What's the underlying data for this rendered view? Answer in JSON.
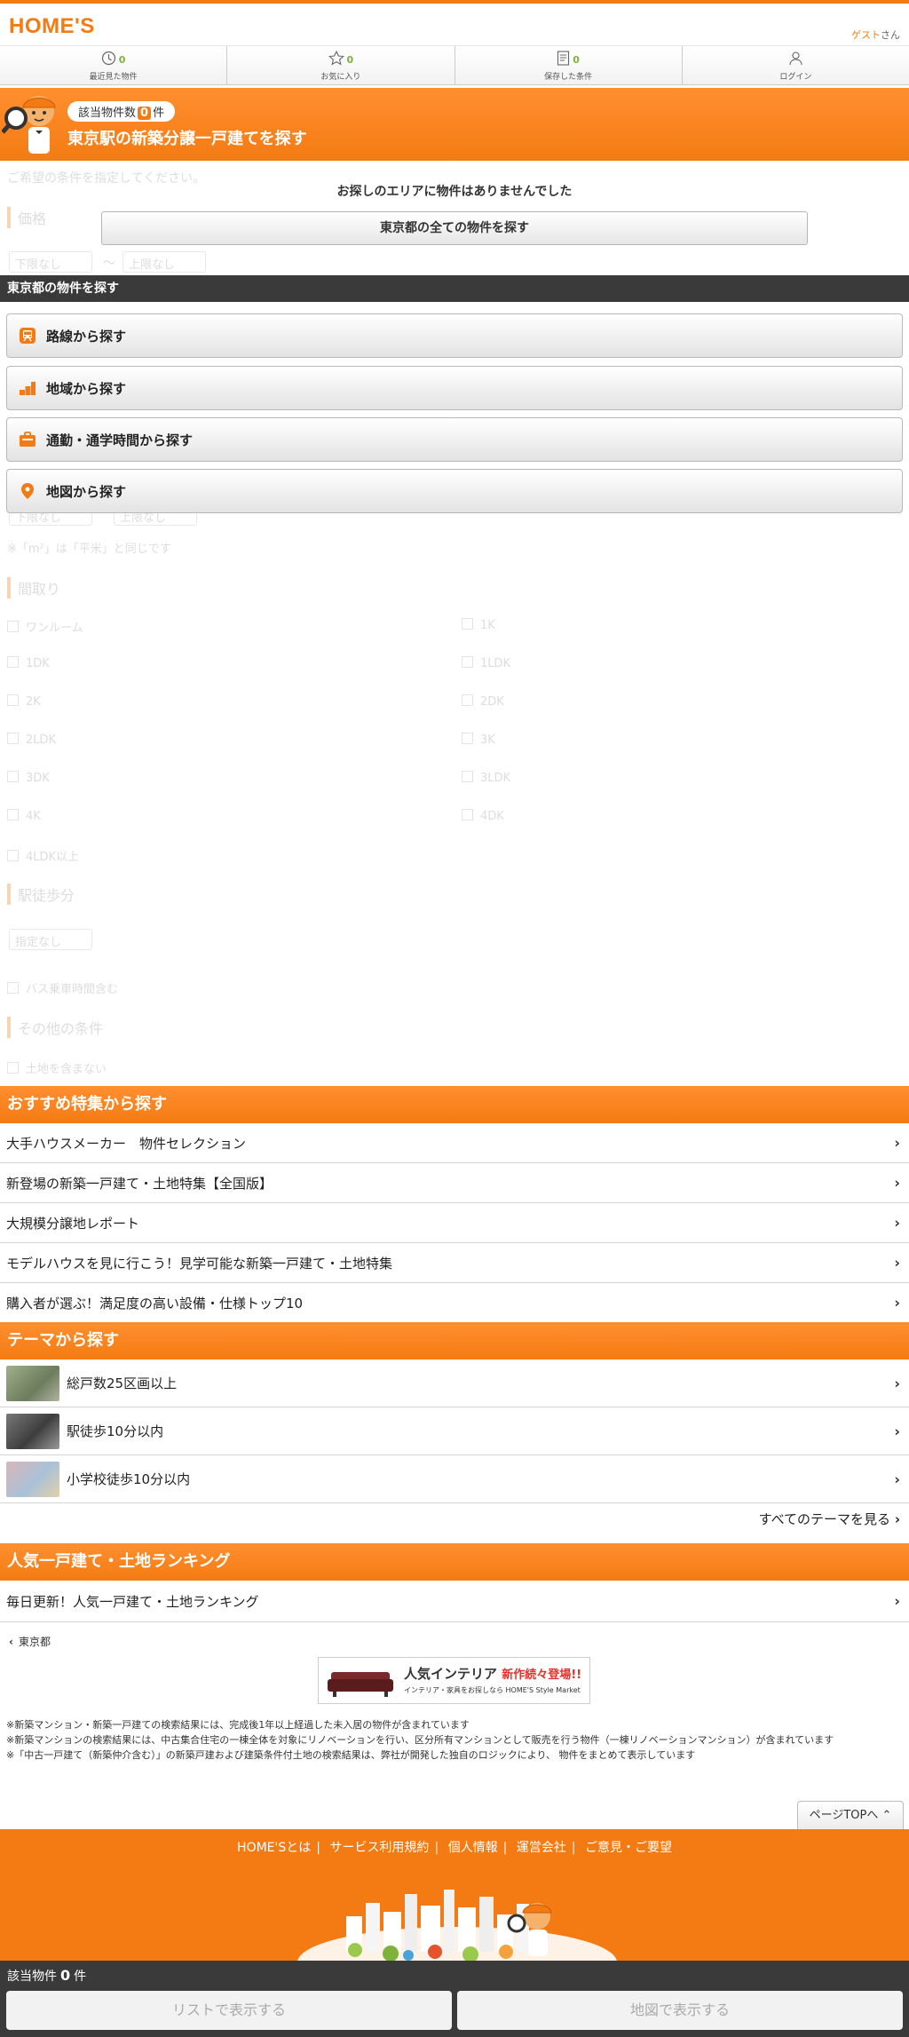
{
  "header": {
    "logo": "HOME'S",
    "guest_name": "ゲスト",
    "guest_suffix": "さん"
  },
  "nav": [
    {
      "label": "最近見た物件",
      "count": "0"
    },
    {
      "label": "お気に入り",
      "count": "0"
    },
    {
      "label": "保存した条件",
      "count": "0"
    },
    {
      "label": "ログイン",
      "count": ""
    }
  ],
  "banner": {
    "count_prefix": "該当物件数",
    "count": "0",
    "count_suffix": "件",
    "title": "東京駅の新築分譲一戸建てを探す"
  },
  "background_form": {
    "intro": "ご希望の条件を指定してください。",
    "price_heading": "価格",
    "price_min": "下限なし",
    "tilde": "～",
    "price_max": "上限なし",
    "area_min": "下限なし",
    "area_max": "上限なし",
    "area_note": "※「m²」は「平米」と同じです",
    "layout_heading": "間取り",
    "layouts": [
      "ワンルーム",
      "1K",
      "1DK",
      "1LDK",
      "2K",
      "2DK",
      "2LDK",
      "3K",
      "3DK",
      "3LDK",
      "4K",
      "4DK",
      "4LDK以上"
    ],
    "walk_heading": "駅徒歩分",
    "walk_select": "指定なし",
    "bus": "バス乗車時間含む",
    "other_heading": "その他の条件",
    "other_opt": "土地を含まない"
  },
  "no_result": {
    "message": "お探しのエリアに物件はありませんでした",
    "button": "東京都の全ての物件を探す"
  },
  "tokyo_search": {
    "heading": "東京都の物件を探す",
    "buttons": [
      {
        "label": "路線から探す",
        "icon": "train-icon"
      },
      {
        "label": "地域から探す",
        "icon": "area-icon"
      },
      {
        "label": "通勤・通学時間から探す",
        "icon": "briefcase-icon"
      },
      {
        "label": "地図から探す",
        "icon": "map-pin-icon"
      }
    ]
  },
  "featured": {
    "heading": "おすすめ特集から探す",
    "items": [
      "大手ハウスメーカー　物件セレクション",
      "新登場の新築一戸建て・土地特集【全国版】",
      "大規模分譲地レポート",
      "モデルハウスを見に行こう！見学可能な新築一戸建て・土地特集",
      "購入者が選ぶ！満足度の高い設備・仕様トップ10"
    ]
  },
  "themes": {
    "heading": "テーマから探す",
    "items": [
      {
        "label": "総戸数25区画以上",
        "thumb_color": "#8a9a7a"
      },
      {
        "label": "駅徒歩10分以内",
        "thumb_color": "#5a5a5a"
      },
      {
        "label": "小学校徒歩10分以内",
        "thumb_color": "#c9a3a8"
      }
    ],
    "see_all": "すべてのテーマを見る"
  },
  "ranking": {
    "heading": "人気一戸建て・土地ランキング",
    "item": "毎日更新！人気一戸建て・土地ランキング"
  },
  "breadcrumb": "東京都",
  "ad": {
    "title": "人気インテリア",
    "highlight": "新作続々登場!!",
    "sub": "インテリア・家具をお探しなら HOME'S Style Market"
  },
  "notes": [
    "※新築マンション・新築一戸建ての検索結果には、完成後1年以上経過した未入居の物件が含まれています",
    "※新築マンションの検索結果には、中古集合住宅の一棟全体を対象にリノベーションを行い、区分所有マンションとして販売を行う物件（一棟リノベーションマンション）が含まれています",
    "※「中古一戸建て（新築仲介含む）」の新築戸建および建築条件付土地の検索結果は、弊社が開発した独自のロジックにより、 物件をまとめて表示しています"
  ],
  "pagetop": "ページTOPへ",
  "footer_links": [
    "HOME'Sとは",
    "サービス利用規約",
    "個人情報",
    "運営会社",
    "ご意見・ご要望"
  ],
  "bottom": {
    "label": "該当物件",
    "count": "0",
    "unit": "件",
    "list_button": "リストで表示する",
    "map_button": "地図で表示する"
  },
  "colors": {
    "accent": "#f47b13",
    "dark": "#3a3a3a",
    "count_green": "#7fb23a"
  }
}
